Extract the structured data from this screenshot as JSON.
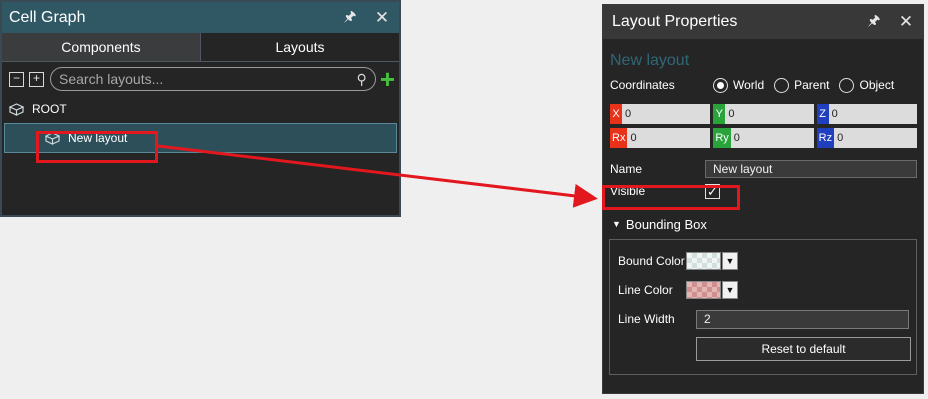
{
  "cell_graph": {
    "title": "Cell Graph",
    "pin_icon": "pin-icon",
    "close_icon": "close-icon",
    "tabs": [
      {
        "label": "Components",
        "active": false
      },
      {
        "label": "Layouts",
        "active": true
      }
    ],
    "search_placeholder": "Search layouts...",
    "tree": {
      "root_label": "ROOT",
      "child_label": "New layout"
    }
  },
  "layout_properties": {
    "title": "Layout Properties",
    "layout_name": "New layout",
    "coordinates": {
      "label": "Coordinates",
      "options": [
        "World",
        "Parent",
        "Object"
      ],
      "selected": "World"
    },
    "position": [
      {
        "tag": "X",
        "value": "0",
        "color": "#e8321a"
      },
      {
        "tag": "Y",
        "value": "0",
        "color": "#2aa33c"
      },
      {
        "tag": "Z",
        "value": "0",
        "color": "#1f3fbf"
      }
    ],
    "rotation": [
      {
        "tag": "Rx",
        "value": "0",
        "color": "#e8321a"
      },
      {
        "tag": "Ry",
        "value": "0",
        "color": "#2aa33c"
      },
      {
        "tag": "Rz",
        "value": "0",
        "color": "#1f3fbf"
      }
    ],
    "name": {
      "label": "Name",
      "value": "New layout"
    },
    "visible": {
      "label": "Visible",
      "checked": true
    },
    "bounding_box": {
      "header": "Bounding Box",
      "bound_color_label": "Bound Color",
      "line_color_label": "Line Color",
      "line_width_label": "Line Width",
      "line_width_value": "2",
      "reset_label": "Reset to default"
    }
  },
  "annotation_color": "#e3171e"
}
